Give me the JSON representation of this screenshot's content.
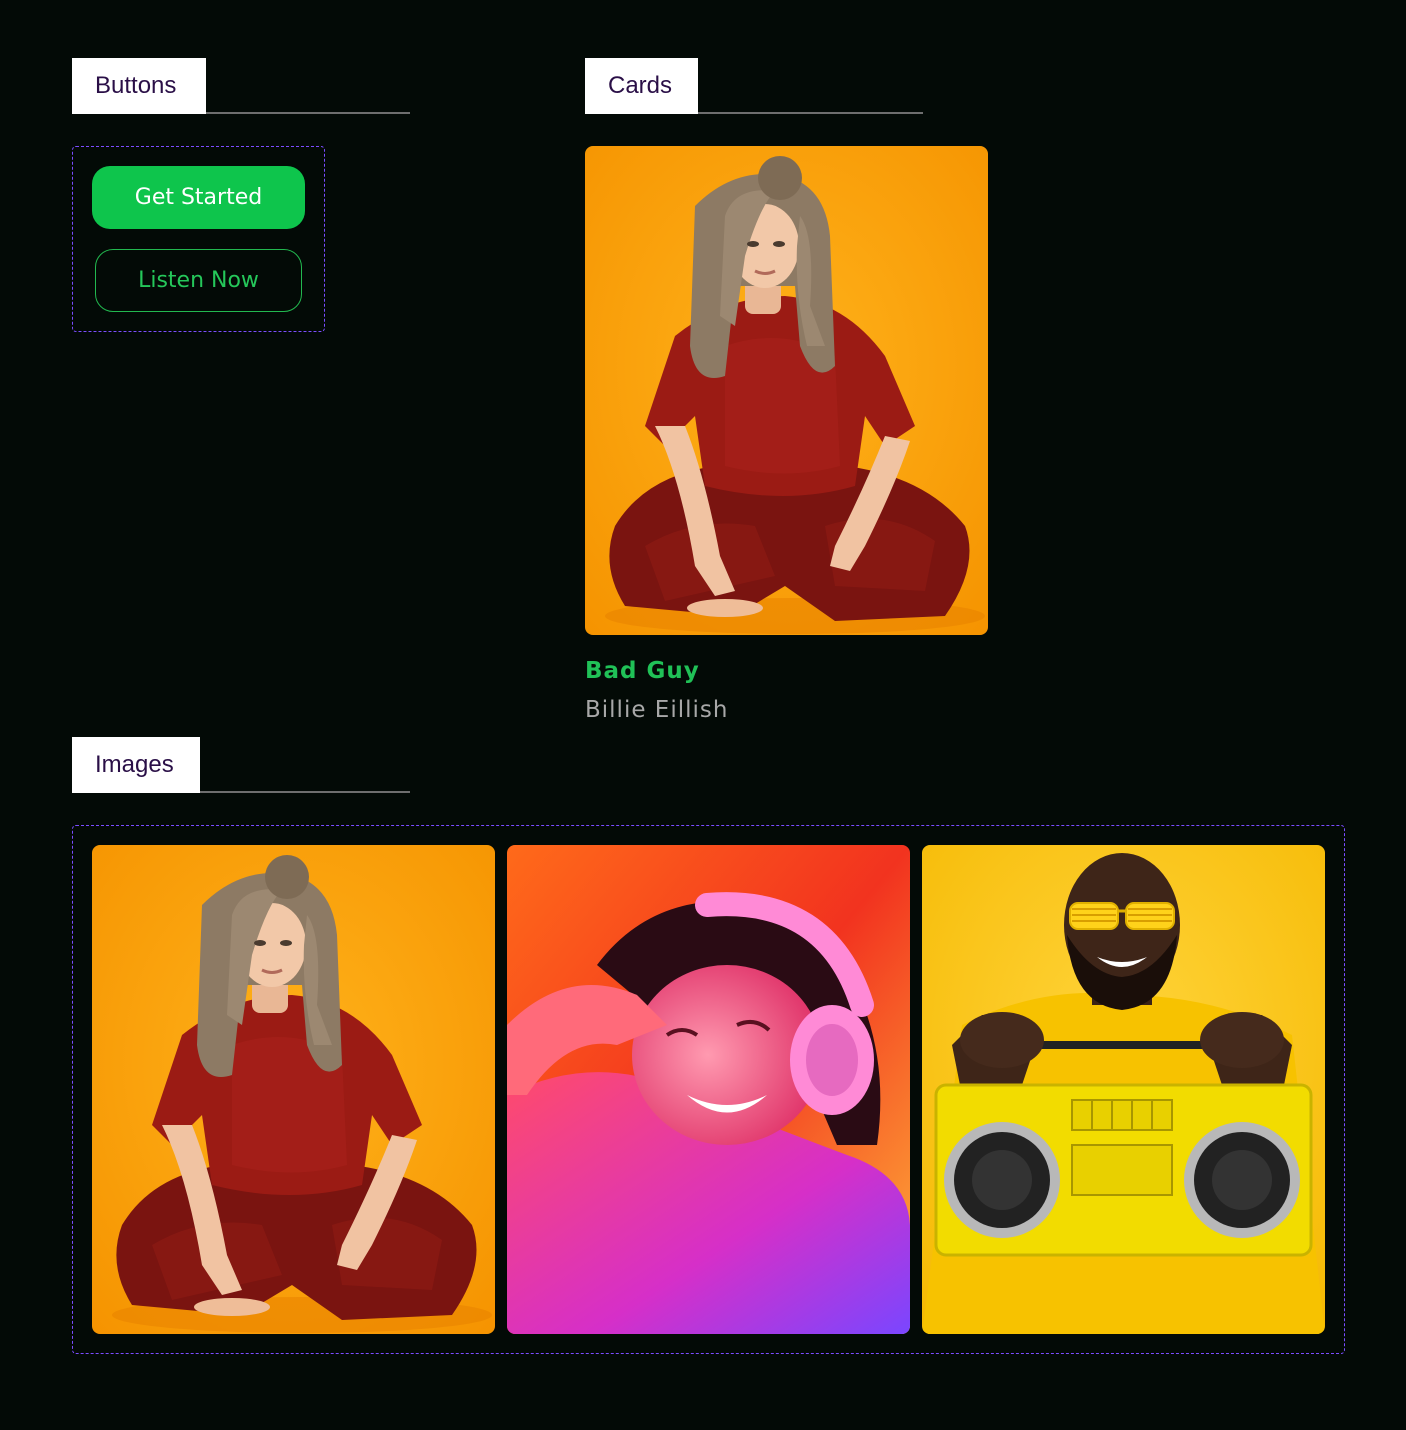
{
  "sections": {
    "buttons": "Buttons",
    "cards": "Cards",
    "images": "Images"
  },
  "buttons": {
    "primary_label": "Get Started",
    "secondary_label": "Listen Now"
  },
  "card": {
    "title": "Bad Guy",
    "subtitle": "Billie Eillish"
  },
  "colors": {
    "background": "#030a06",
    "accent_green": "#0ec54c",
    "dashed_border": "#7b4cff",
    "header_text": "#2a0f47"
  }
}
